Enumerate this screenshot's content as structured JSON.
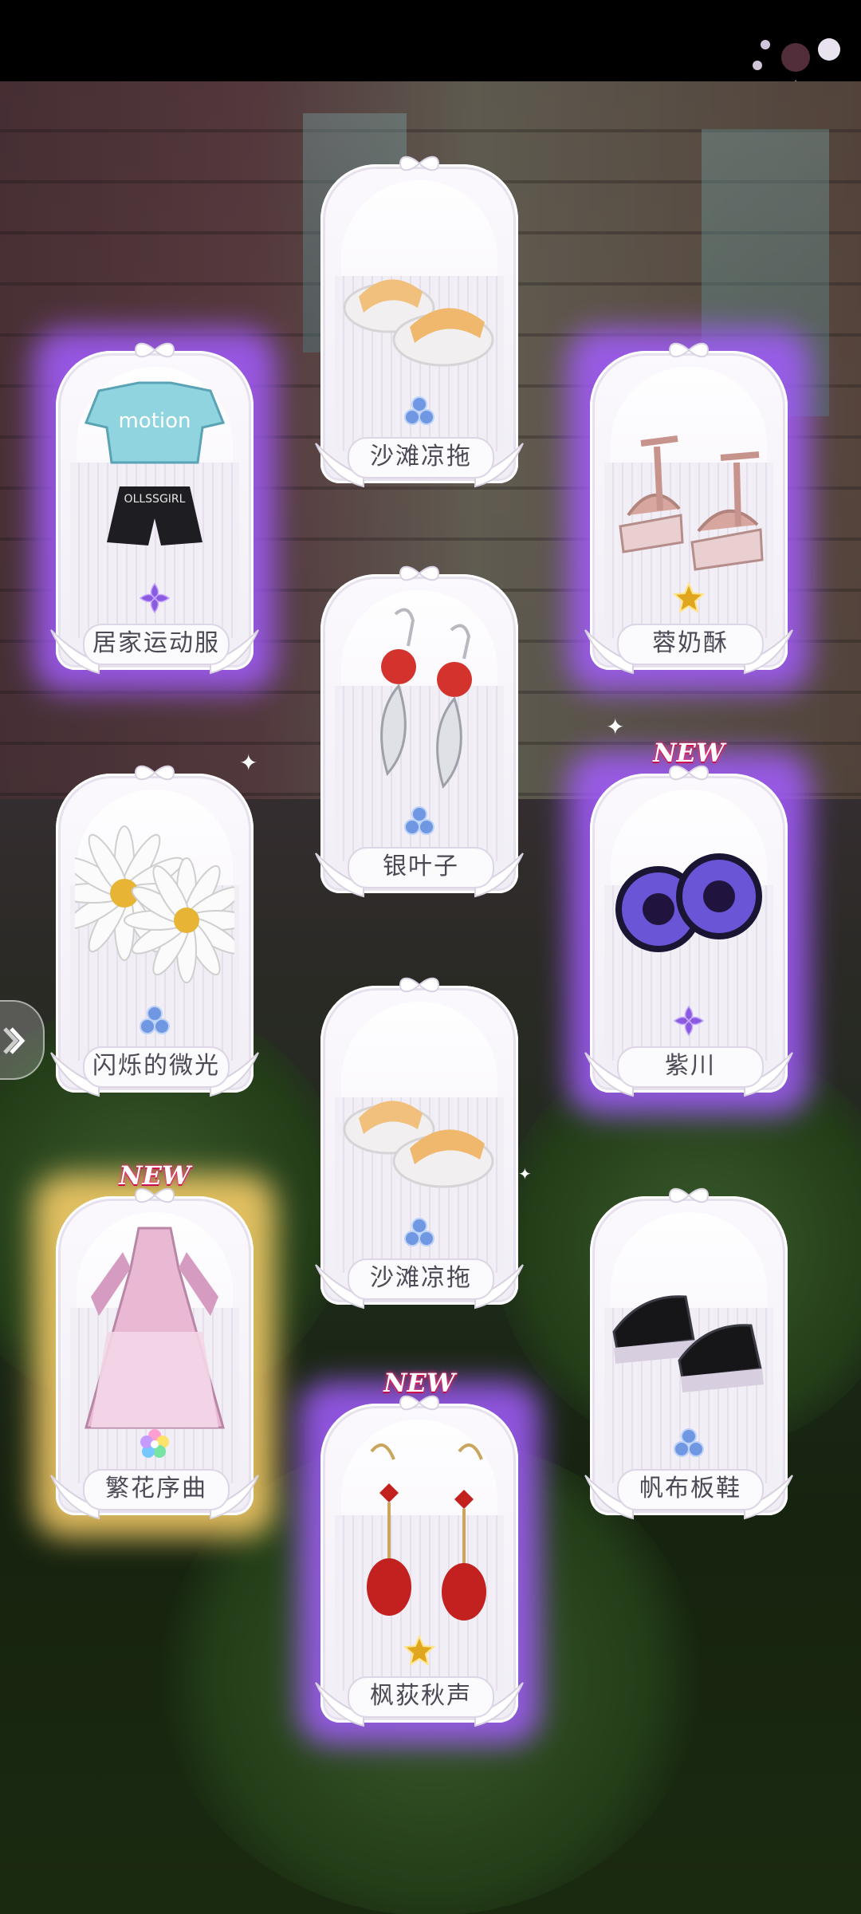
{
  "screen": {
    "background": "#1b1618",
    "topbar": "#000000"
  },
  "cards": [
    {
      "id": "c1",
      "label": "居家运动服",
      "gem": "purple",
      "glow": "purple",
      "new": false,
      "art": "outfit"
    },
    {
      "id": "c2",
      "label": "沙滩凉拖",
      "gem": "blue",
      "glow": "none",
      "new": false,
      "art": "slides"
    },
    {
      "id": "c3",
      "label": "蓉奶酥",
      "gem": "gold",
      "glow": "purple",
      "new": false,
      "art": "sandals"
    },
    {
      "id": "c4",
      "label": "银叶子",
      "gem": "blue",
      "glow": "none",
      "new": false,
      "art": "earrings-leaf"
    },
    {
      "id": "c5",
      "label": "闪烁的微光",
      "gem": "blue",
      "glow": "none",
      "new": false,
      "art": "daisy"
    },
    {
      "id": "c6",
      "label": "紫川",
      "gem": "purple",
      "glow": "purple",
      "new": true,
      "art": "lenses"
    },
    {
      "id": "c7",
      "label": "沙滩凉拖",
      "gem": "blue",
      "glow": "none",
      "new": false,
      "art": "slides"
    },
    {
      "id": "c8",
      "label": "繁花序曲",
      "gem": "rainbow",
      "glow": "gold",
      "new": true,
      "art": "dress"
    },
    {
      "id": "c9",
      "label": "帆布板鞋",
      "gem": "blue",
      "glow": "none",
      "new": false,
      "art": "sneakers"
    },
    {
      "id": "c10",
      "label": "枫荻秋声",
      "gem": "gold",
      "glow": "purple",
      "new": true,
      "art": "earrings-red"
    }
  ],
  "badges": {
    "new_text": "NEW"
  },
  "colors": {
    "purple_glow": "#a35cff",
    "gold_glow": "#ffd36b",
    "blue_gem": "#8fb4f0",
    "purple_gem": "#b58cf0",
    "gold_gem": "#f2c84b"
  },
  "nav": {
    "side_button_icon": "double-chevron-icon"
  }
}
